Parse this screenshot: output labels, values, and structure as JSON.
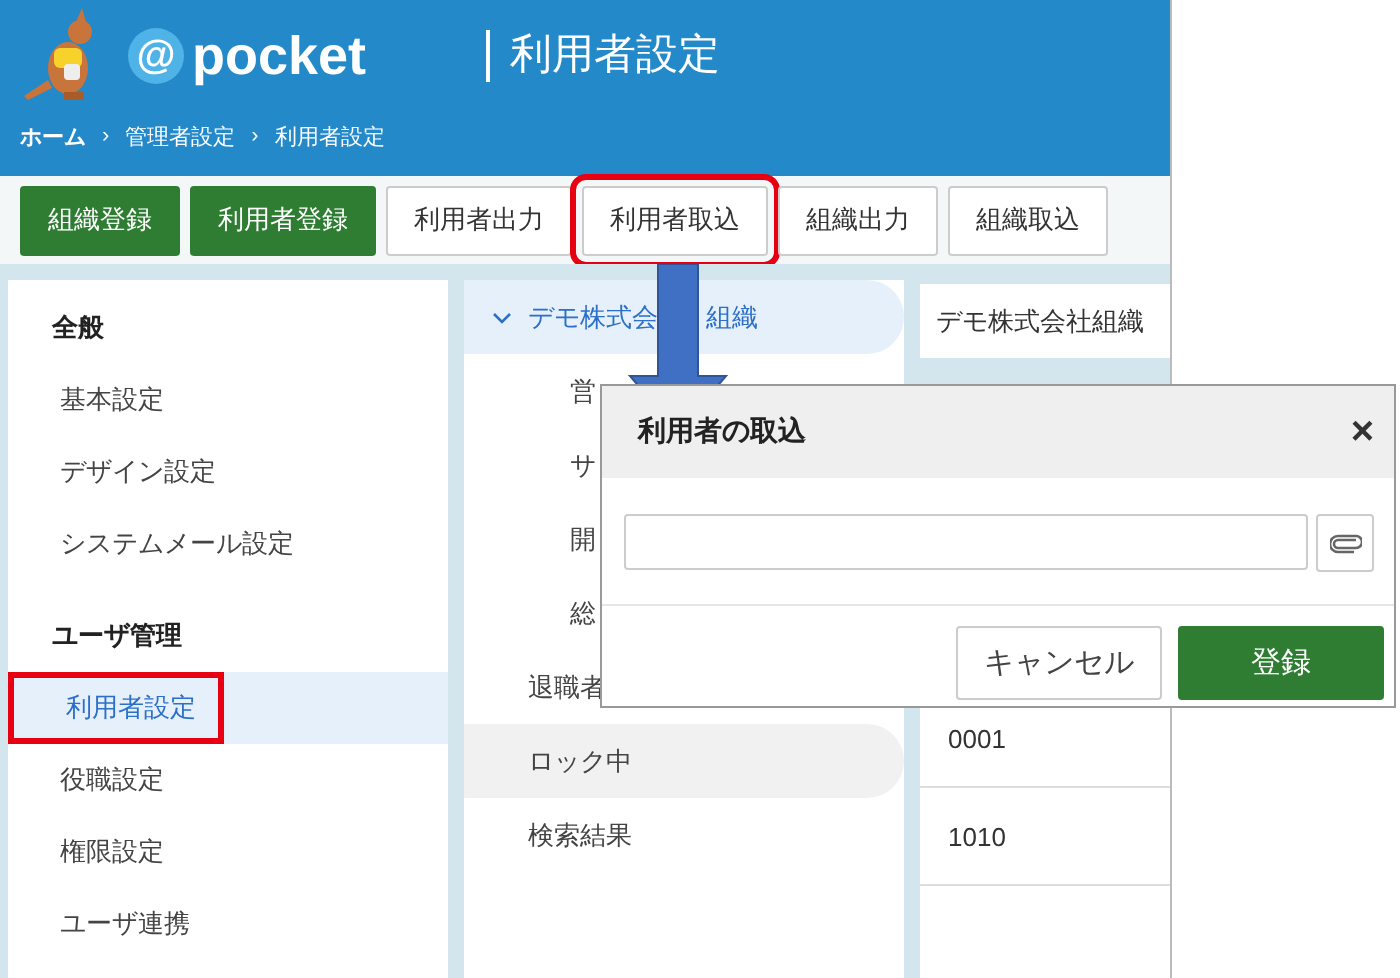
{
  "header": {
    "logo": {
      "at": "@",
      "name": "pocket"
    },
    "title": "利用者設定",
    "breadcrumb": [
      "ホーム",
      "›",
      "管理者設定",
      "›",
      "利用者設定"
    ]
  },
  "toolbar": [
    {
      "label": "組織登録",
      "kind": "primary",
      "annotated": false
    },
    {
      "label": "利用者登録",
      "kind": "primary",
      "annotated": false
    },
    {
      "label": "利用者出力",
      "kind": "plain",
      "annotated": false
    },
    {
      "label": "利用者取込",
      "kind": "plain",
      "annotated": true
    },
    {
      "label": "組織出力",
      "kind": "plain",
      "annotated": false
    },
    {
      "label": "組織取込",
      "kind": "plain",
      "annotated": false
    }
  ],
  "sidebar": [
    {
      "title": "全般",
      "items": [
        {
          "label": "基本設定",
          "selected": false,
          "annotated": false
        },
        {
          "label": "デザイン設定",
          "selected": false,
          "annotated": false
        },
        {
          "label": "システムメール設定",
          "selected": false,
          "annotated": false
        }
      ]
    },
    {
      "title": "ユーザ管理",
      "items": [
        {
          "label": "利用者設定",
          "selected": true,
          "annotated": true
        },
        {
          "label": "役職設定",
          "selected": false,
          "annotated": false
        },
        {
          "label": "権限設定",
          "selected": false,
          "annotated": false
        },
        {
          "label": "ユーザ連携",
          "selected": false,
          "annotated": false
        }
      ]
    }
  ],
  "tree": [
    {
      "label_parts": [
        "デモ株式会",
        "組織"
      ],
      "selected": true,
      "hovered": false,
      "expanded": true,
      "children": [
        {
          "label": "営"
        },
        {
          "label": "サ"
        },
        {
          "label": "開"
        },
        {
          "label": "総"
        }
      ]
    },
    {
      "label": "退職者",
      "selected": false,
      "hovered": false
    },
    {
      "label": "ロック中",
      "selected": false,
      "hovered": true
    },
    {
      "label": "検索結果",
      "selected": false,
      "hovered": false
    }
  ],
  "detail": {
    "heading": "デモ株式会社組織",
    "rows": [
      "0001",
      "1010"
    ]
  },
  "dialog": {
    "title": "利用者の取込",
    "close": "×",
    "buttons": [
      {
        "label": "キャンセル",
        "kind": "plain"
      },
      {
        "label": "登録",
        "kind": "primary"
      }
    ]
  }
}
